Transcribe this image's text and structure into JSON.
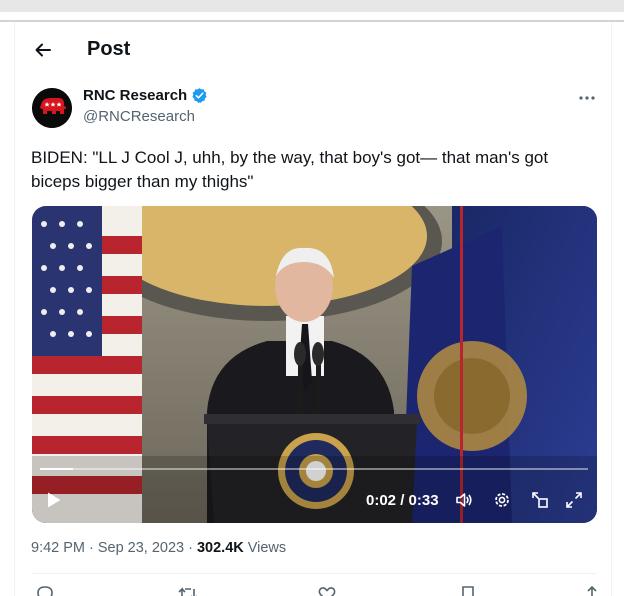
{
  "header": {
    "title": "Post"
  },
  "author": {
    "name": "RNC Research",
    "handle": "@RNCResearch"
  },
  "post": {
    "text": "BIDEN: \"LL J Cool J, uhh, by the way, that boy's got— that man's got biceps bigger than my thighs\"",
    "time": "9:42 PM",
    "date": "Sep 23, 2023",
    "separator": "·",
    "views_count": "302.4K",
    "views_label": "Views"
  },
  "video": {
    "time_readout": "0:02 / 0:33",
    "progress_fraction": 0.06
  },
  "colors": {
    "verified_badge": "#1d9bf0",
    "avatar_bg": "#0a0a0a",
    "rnc_red": "#d6151c",
    "text_secondary": "#536471"
  },
  "icons": {
    "back": "arrow-left-icon",
    "more": "more-horizontal-icon",
    "verified": "verified-badge-icon",
    "play": "play-icon",
    "volume": "volume-icon",
    "settings": "gear-icon",
    "pip": "picture-in-picture-icon",
    "fullscreen": "fullscreen-icon"
  }
}
